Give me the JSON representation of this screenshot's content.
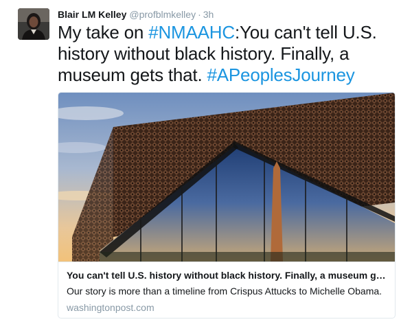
{
  "tweet": {
    "author_name": "Blair LM Kelley",
    "author_handle": "@profblmkelley",
    "separator": "·",
    "timestamp": "3h",
    "text_segments": [
      {
        "text": "My take on ",
        "hashtag": false
      },
      {
        "text": "#NMAAHC",
        "hashtag": true
      },
      {
        "text": ":You can't tell U.S. history without black history. Finally, a museum gets that. ",
        "hashtag": false
      },
      {
        "text": "#APeoplesJourney",
        "hashtag": true
      }
    ]
  },
  "card": {
    "image_subject": "museum-facade-with-washington-monument-reflection",
    "title": "You can't tell U.S. history without black history. Finally, a museum get...",
    "description": "Our story is more than a timeline from Crispus Attucks to Michelle Obama.",
    "domain": "washingtonpost.com"
  },
  "colors": {
    "text": "#14171a",
    "muted": "#8899a6",
    "link": "#1b95e0",
    "border": "#e1e8ed"
  }
}
